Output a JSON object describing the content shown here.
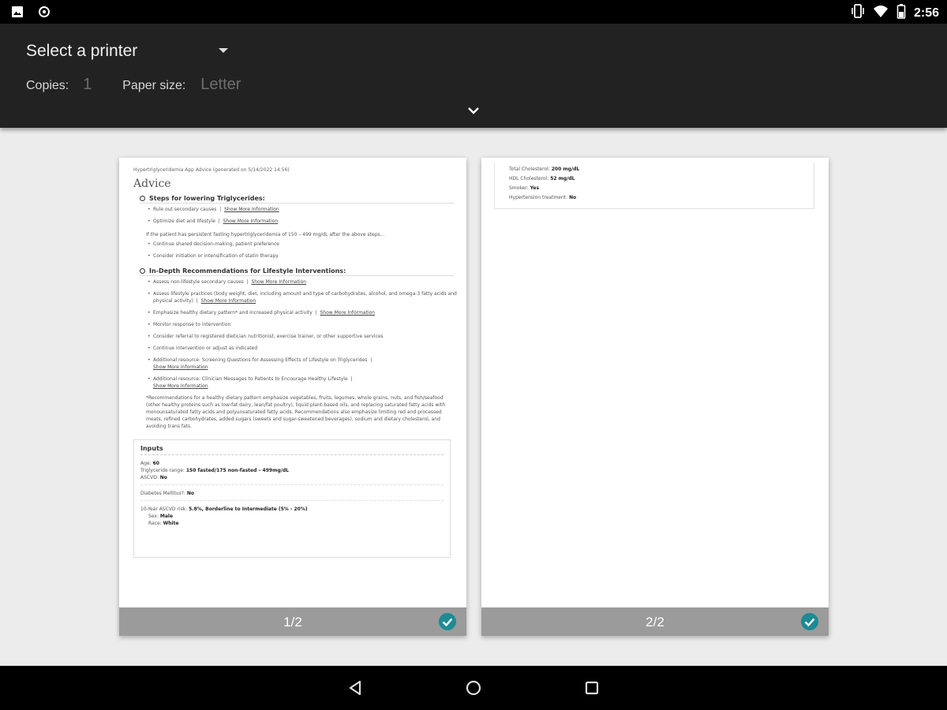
{
  "status_bar": {
    "time": "2:56",
    "left_icons": [
      "image-icon",
      "sync-icon"
    ],
    "right_icons": [
      "vibrate-icon",
      "wifi-icon",
      "battery-icon"
    ]
  },
  "header": {
    "printer_select": "Select a printer",
    "copies_label": "Copies:",
    "copies_value": "1",
    "paper_size_label": "Paper size:",
    "paper_size_value": "Letter"
  },
  "pages": [
    {
      "number_label": "1/2",
      "checked": true,
      "doc": {
        "meta": "Hypertriglyceridemia App Advice (generated on 5/14/2022 14:56)",
        "title": "Advice",
        "sections": [
          {
            "title": "Steps for lowering Triglycerides:",
            "items": [
              {
                "text": "Rule out secondary causes",
                "link": "Show More Information"
              },
              {
                "text": "Optimize diet and lifestyle",
                "link": "Show More Information"
              }
            ],
            "note": "If the patient has persistent fasting hypertriglyceridemia of 150 – 499 mg/dL after the above steps...",
            "note_items": [
              {
                "text": "Continue shared decision-making, patient preference",
                "link": ""
              },
              {
                "text": "Consider initiation or intensification of statin therapy",
                "link": ""
              }
            ]
          },
          {
            "title": "In-Depth Recommendations for Lifestyle Interventions:",
            "items": [
              {
                "text": "Assess non-lifestyle secondary causes",
                "link": "Show More Information"
              },
              {
                "text": "Assess lifestyle practices (body weight, diet, including amount and type of carbohydrates, alcohol, and omega-3 fatty acids and physical activity)",
                "link": "Show More Information"
              },
              {
                "text": "Emphasize healthy dietary pattern* and increased physical activity",
                "link": "Show More Information"
              },
              {
                "text": "Monitor response to intervention",
                "link": ""
              },
              {
                "text": "Consider referral to registered dietician nutritionist, exercise trainer, or other supportive services",
                "link": ""
              },
              {
                "text": "Continue intervention or adjust as indicated",
                "link": ""
              },
              {
                "text": "Additional resource: Screening Questions for Assessing Effects of Lifestyle on Triglycerides",
                "link": "Show More Information"
              },
              {
                "text": "Additional resource: Clinician Messages to Patients to Encourage Healthy Lifestyle",
                "link": "Show More Information"
              }
            ],
            "footnote": "*Recommendations for a healthy dietary pattern emphasize vegetables, fruits, legumes, whole grains, nuts, and fish/seafood (other healthy proteins such as low-fat dairy, lean/fat poultry), liquid plant-based oils, and replacing saturated fatty acids with monounsaturated fatty acids and polyunsaturated fatty acids. Recommendations also emphasize limiting red and processed meats, refined carbohydrates, added sugars (sweets and sugar-sweetened beverages), sodium and dietary cholesterol, and avoiding trans fats."
          }
        ],
        "inputs": {
          "title": "Inputs",
          "age_label": "Age:",
          "age_value": "60",
          "tg_label": "Triglyceride range:",
          "tg_value": "150 fasted/175 non-fasted – 499mg/dL",
          "ascvd_label": "ASCVD:",
          "ascvd_value": "No",
          "diabetes_label": "Diabetes Mellitus?:",
          "diabetes_value": "No",
          "risk_label": "10-Year ASCVD risk:",
          "risk_value": "5.8%, Borderline to Intermediate (5% - 20%)",
          "sex_label": "Sex:",
          "sex_value": "Male",
          "race_label": "Race:",
          "race_value": "White"
        }
      }
    },
    {
      "number_label": "2/2",
      "checked": true,
      "doc": {
        "rows": [
          {
            "label": "Total Cholesterol:",
            "value": "200 mg/dL"
          },
          {
            "label": "HDL Cholesterol:",
            "value": "52 mg/dL"
          },
          {
            "label": "Smoker:",
            "value": "Yes"
          },
          {
            "label": "Hypertension treatment:",
            "value": "No"
          }
        ]
      }
    }
  ],
  "nav_bar": {
    "buttons": [
      "back-icon",
      "home-icon",
      "recents-icon"
    ]
  },
  "colors": {
    "header_bg": "#222222",
    "preview_bg": "#ececec",
    "page_footer": "#9b9b9b",
    "check_accent": "#1e8a94"
  }
}
